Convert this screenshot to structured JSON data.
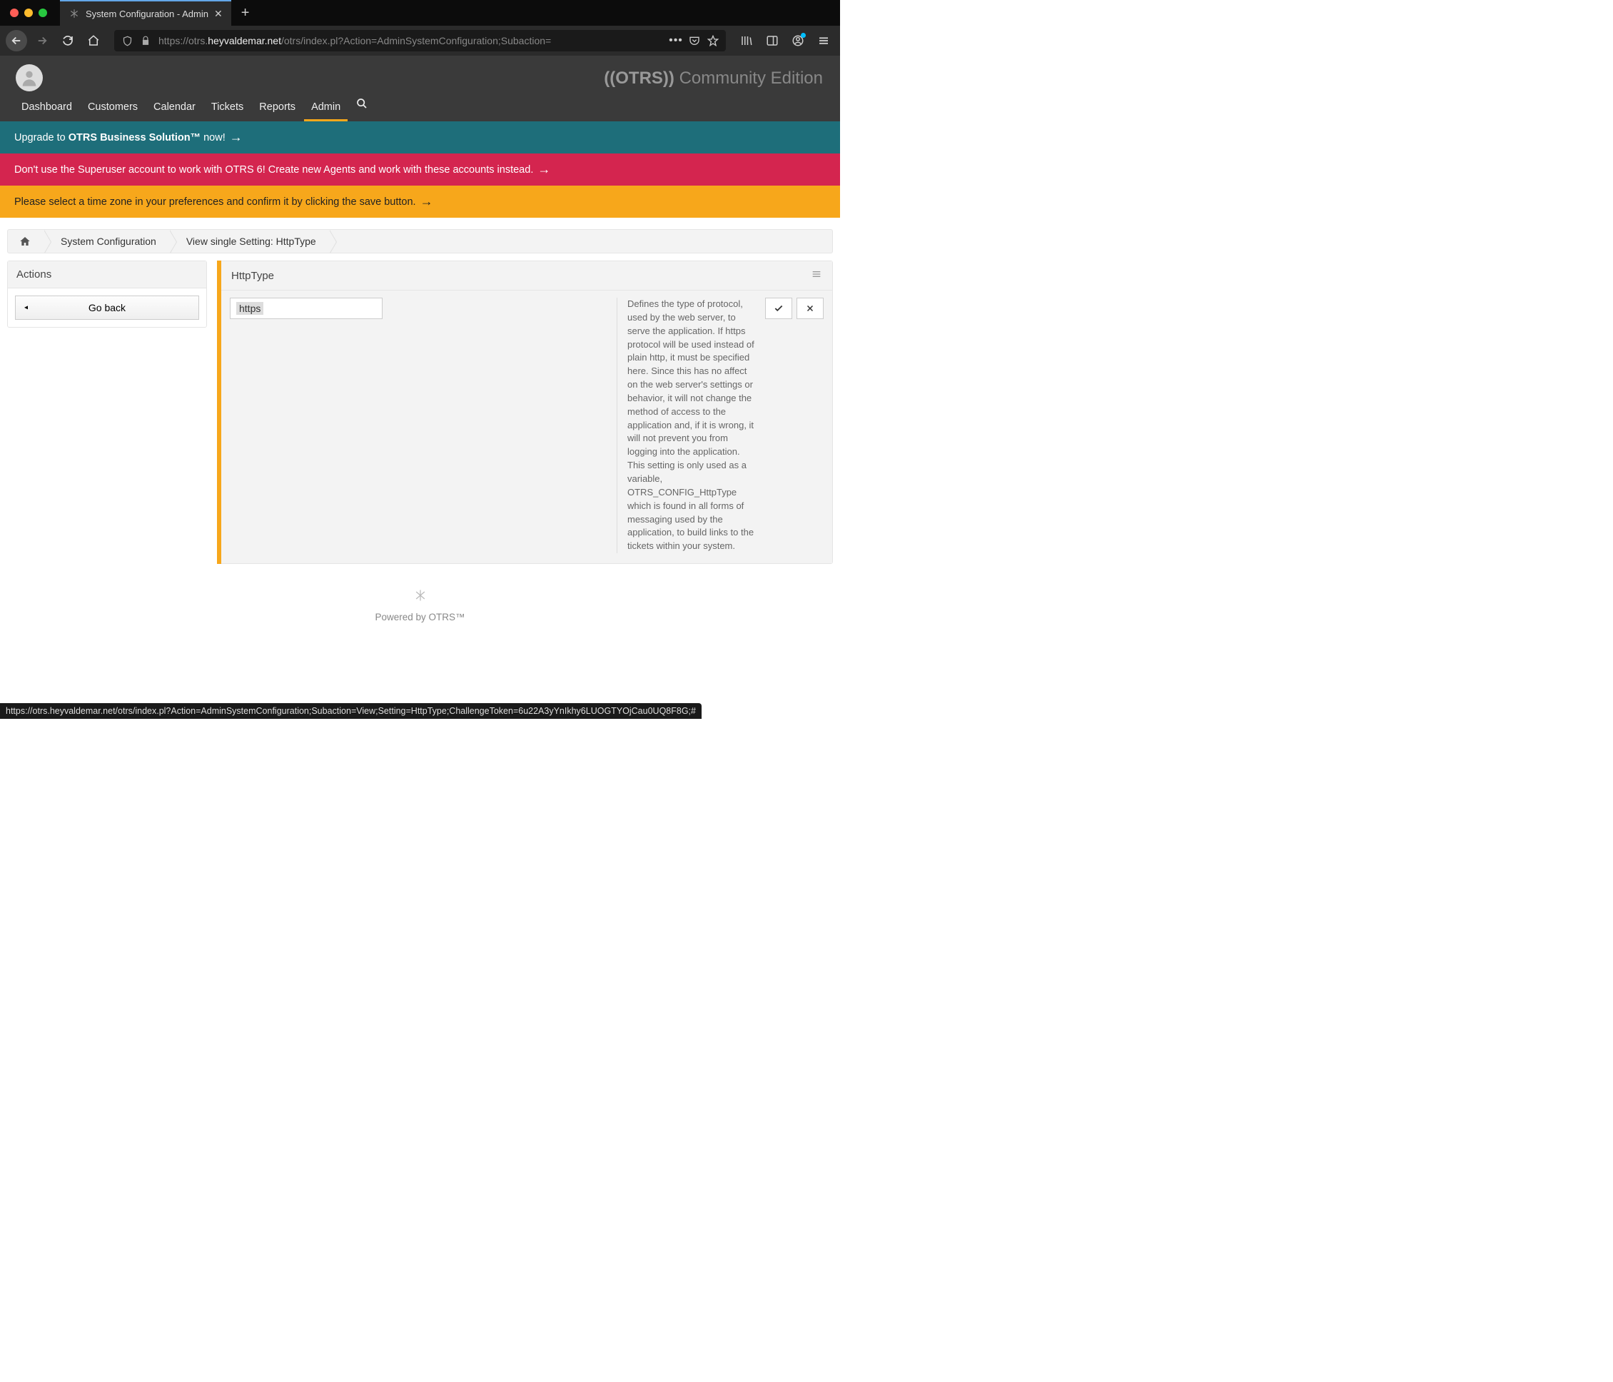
{
  "browser": {
    "tab_title": "System Configuration - Admin",
    "url_prefix": "https://otrs.",
    "url_domain": "heyvaldemar.net",
    "url_suffix": "/otrs/index.pl?Action=AdminSystemConfiguration;Subaction="
  },
  "app": {
    "brand_otrs": "((OTRS))",
    "brand_edition": " Community Edition",
    "nav": {
      "dashboard": "Dashboard",
      "customers": "Customers",
      "calendar": "Calendar",
      "tickets": "Tickets",
      "reports": "Reports",
      "admin": "Admin"
    }
  },
  "banners": {
    "teal_pre": "Upgrade to ",
    "teal_bold": "OTRS Business Solution™",
    "teal_post": " now!",
    "red": "Don't use the Superuser account to work with OTRS 6! Create new Agents and work with these accounts instead.",
    "yellow": "Please select a time zone in your preferences and confirm it by clicking the save button."
  },
  "breadcrumb": {
    "sysconfig": "System Configuration",
    "view": "View single Setting: HttpType"
  },
  "sidebar": {
    "actions_title": "Actions",
    "go_back": "Go back"
  },
  "setting": {
    "name": "HttpType",
    "value": "https",
    "description": "Defines the type of protocol, used by the web server, to serve the application. If https protocol will be used instead of plain http, it must be specified here. Since this has no affect on the web server's settings or behavior, it will not change the method of access to the application and, if it is wrong, it will not prevent you from logging into the application. This setting is only used as a variable, OTRS_CONFIG_HttpType which is found in all forms of messaging used by the application, to build links to the tickets within your system."
  },
  "footer": {
    "powered": "Powered by OTRS™"
  },
  "status_url": "https://otrs.heyvaldemar.net/otrs/index.pl?Action=AdminSystemConfiguration;Subaction=View;Setting=HttpType;ChallengeToken=6u22A3yYnIkhy6LUOGTYOjCau0UQ8F8G;#"
}
